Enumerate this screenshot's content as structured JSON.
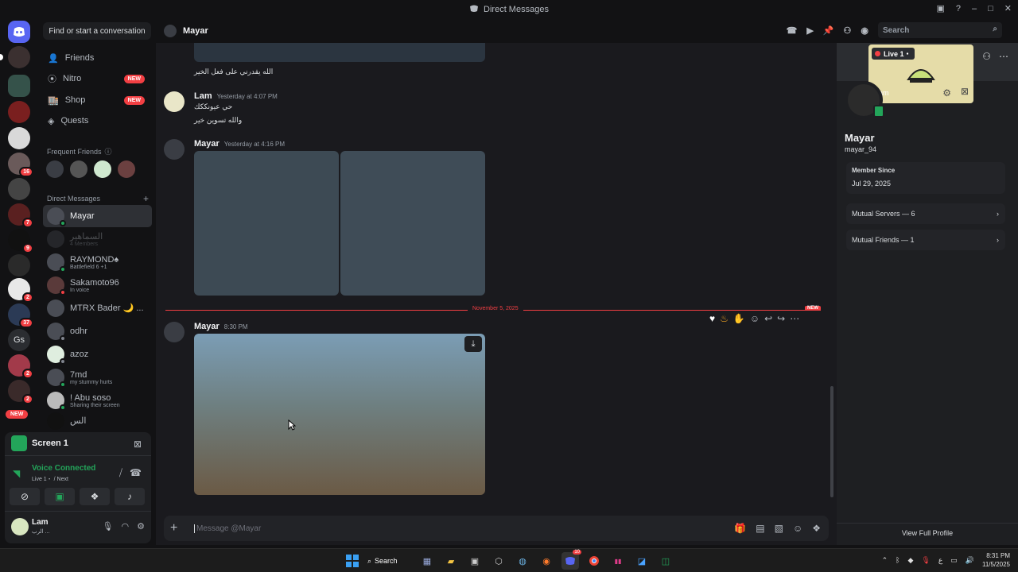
{
  "window": {
    "title": "Direct Messages"
  },
  "servers": {
    "badges": [
      "16",
      "7",
      "9",
      "2",
      "37",
      "2",
      "2"
    ],
    "gs_label": "Gs",
    "new_label": "NEW"
  },
  "dm_sidebar": {
    "find_placeholder": "Find or start a conversation",
    "nav": [
      {
        "label": "Friends",
        "icon": "friends-icon"
      },
      {
        "label": "Nitro",
        "icon": "nitro-icon",
        "badge": "NEW"
      },
      {
        "label": "Shop",
        "icon": "shop-icon",
        "badge": "NEW"
      },
      {
        "label": "Quests",
        "icon": "quests-icon"
      }
    ],
    "frequent_friends_label": "Frequent Friends",
    "direct_messages_label": "Direct Messages",
    "dms": [
      {
        "name": "Mayar",
        "sub": "",
        "selected": true
      },
      {
        "name": "السماهير",
        "sub": "4 Members",
        "dim": true
      },
      {
        "name": "RAYMOND♠",
        "sub": "Battlefield 6 +1"
      },
      {
        "name": "Sakamoto96",
        "sub": "In voice"
      },
      {
        "name": "MTRX Bader 🌙 ...",
        "sub": ""
      },
      {
        "name": "odhr",
        "sub": ""
      },
      {
        "name": "azoz",
        "sub": ""
      },
      {
        "name": "7md",
        "sub": "my stummy hurts"
      },
      {
        "name": "! Abu soso",
        "sub": "Sharing their screen"
      },
      {
        "name": "الس",
        "sub": ""
      }
    ]
  },
  "voice_panel": {
    "stream_title": "Screen 1",
    "voice_status": "Voice Connected",
    "voice_channel": "Live 1・ / Next",
    "user_name": "Lam",
    "user_sub": "الرب ..."
  },
  "chat": {
    "header_name": "Mayar",
    "search_placeholder": "Search",
    "messages": [
      {
        "text": "الله يقدرني على فعل الخير"
      },
      {
        "author": "Lam",
        "time": "Yesterday at 4:07 PM",
        "lines": [
          "حي عيونككك",
          "والله تسوين خير"
        ]
      },
      {
        "author": "Mayar",
        "time": "Yesterday at 4:16 PM"
      },
      {
        "author": "Mayar",
        "time": "8:30 PM"
      }
    ],
    "date_divider": "November 5, 2025",
    "new_label": "NEW",
    "composer_placeholder": "Message @Mayar"
  },
  "profile": {
    "stream_title": "Live 1・",
    "stream_user": "Lam",
    "display_name": "Mayar",
    "username": "mayar_94",
    "member_since_label": "Member Since",
    "member_since": "Jul 29, 2025",
    "mutual_servers": "Mutual Servers — 6",
    "mutual_friends": "Mutual Friends — 1",
    "view_full": "View Full Profile"
  },
  "taskbar": {
    "search_label": "Search",
    "tray_lang": "ع",
    "time": "8:31 PM",
    "date": "11/5/2025",
    "discord_badge": "10"
  },
  "colors": {
    "accent": "#5865f2",
    "danger": "#f23f43",
    "online": "#23a55a"
  }
}
